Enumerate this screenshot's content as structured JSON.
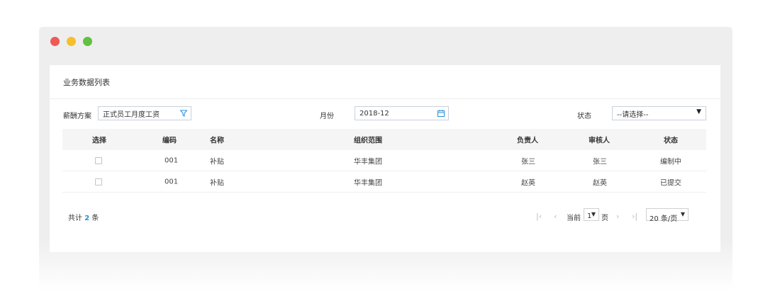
{
  "window": {
    "controls": {
      "close_color": "#ee5a55",
      "minimize_color": "#f5bf2d",
      "maximize_color": "#5fc13f"
    }
  },
  "panel": {
    "title": "业务数据列表"
  },
  "filters": {
    "scheme_label": "薪酬方案",
    "scheme_value": "正式员工月度工资",
    "scheme_icon": "filter-icon",
    "month_label": "月份",
    "month_value": "2018-12",
    "month_icon": "calendar-icon",
    "status_label": "状态",
    "status_value": "--请选择--"
  },
  "table": {
    "columns": [
      "选择",
      "编码",
      "名称",
      "组织范围",
      "负责人",
      "审核人",
      "状态"
    ],
    "rows": [
      {
        "checked": false,
        "code": "001",
        "name": "补贴",
        "org": "华丰集团",
        "owner": "张三",
        "reviewer": "张三",
        "status": "编制中"
      },
      {
        "checked": false,
        "code": "001",
        "name": "补贴",
        "org": "华丰集团",
        "owner": "赵英",
        "reviewer": "赵英",
        "status": "已提交"
      }
    ]
  },
  "footer": {
    "total_prefix": "共计",
    "total_count": "2",
    "total_suffix": "条",
    "current_label": "当前",
    "current_page": "1",
    "page_suffix": "页",
    "page_size": "20 条/页",
    "accent_color": "#2a8fd6"
  }
}
